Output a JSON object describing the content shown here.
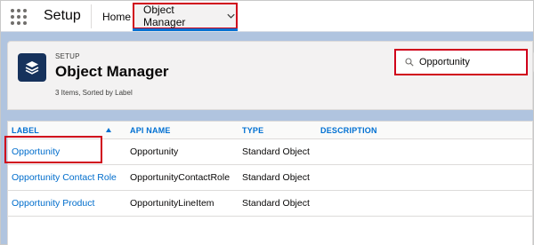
{
  "app": {
    "name": "Setup"
  },
  "nav": {
    "home": "Home",
    "object_manager": "Object Manager"
  },
  "header": {
    "eyebrow": "SETUP",
    "title": "Object Manager",
    "meta": "3 Items, Sorted by Label"
  },
  "search": {
    "value": "Opportunity",
    "placeholder": "Quick Find"
  },
  "table": {
    "columns": [
      "LABEL",
      "API NAME",
      "TYPE",
      "DESCRIPTION"
    ],
    "rows": [
      {
        "label": "Opportunity",
        "api_name": "Opportunity",
        "type": "Standard Object",
        "description": ""
      },
      {
        "label": "Opportunity Contact Role",
        "api_name": "OpportunityContactRole",
        "type": "Standard Object",
        "description": ""
      },
      {
        "label": "Opportunity Product",
        "api_name": "OpportunityLineItem",
        "type": "Standard Object",
        "description": ""
      }
    ]
  },
  "colors": {
    "brand_blue": "#0070d2",
    "link_blue": "#006dcc",
    "highlight_red": "#d0021b",
    "icon_navy": "#16325c"
  },
  "icons": {
    "app_launcher": "app-launcher-icon",
    "nav_dropdown": "chevron-down-icon",
    "object": "stack-layers-icon",
    "search": "search-icon",
    "sort": "sort-ascending-icon"
  }
}
